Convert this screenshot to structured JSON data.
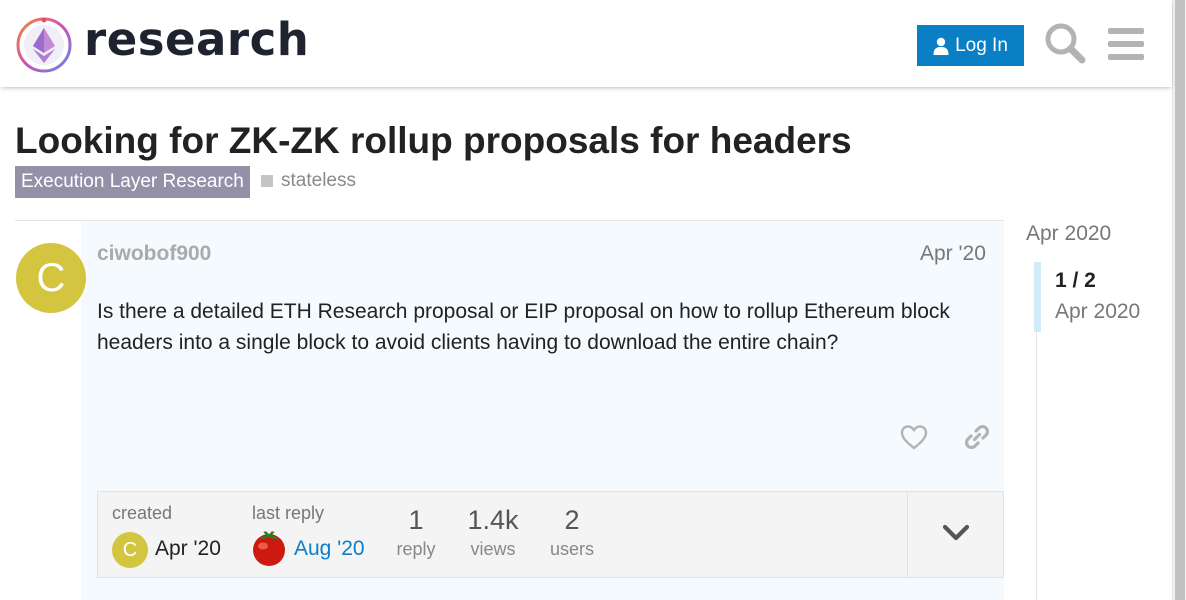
{
  "header": {
    "brand": "research",
    "login_label": "Log In",
    "search_icon": "search-icon",
    "menu_icon": "hamburger-menu-icon"
  },
  "topic": {
    "title": "Looking for ZK-ZK rollup proposals for headers",
    "category": "Execution Layer Research",
    "category_color": "#958fa8",
    "tag": "stateless"
  },
  "post": {
    "avatar_letter": "C",
    "avatar_color": "#d4c540",
    "username": "ciwobof900",
    "date": "Apr '20",
    "body": "Is there a detailed ETH Research proposal or EIP proposal on how to rollup Ethereum block headers into a single block to avoid clients having to download the entire chain?"
  },
  "topic_map": {
    "created_label": "created",
    "created_date": "Apr '20",
    "created_avatar_letter": "C",
    "last_reply_label": "last reply",
    "last_reply_date": "Aug '20",
    "stats": [
      {
        "value": "1",
        "label": "reply"
      },
      {
        "value": "1.4k",
        "label": "views"
      },
      {
        "value": "2",
        "label": "users"
      }
    ]
  },
  "timeline": {
    "start": "Apr 2020",
    "position": "1 / 2",
    "current_date": "Apr 2020"
  },
  "colors": {
    "accent": "#0a7fc6",
    "link": "#0a7fc6"
  }
}
